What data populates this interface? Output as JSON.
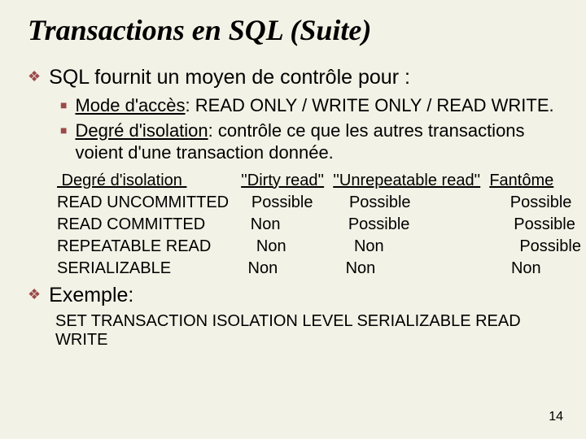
{
  "title": "Transactions en SQL (Suite)",
  "b1_intro": "SQL fournit un moyen de contrôle pour :",
  "sub1_label": "Mode d'accès",
  "sub1_rest": ": READ ONLY / WRITE ONLY / READ WRITE.",
  "sub2_label": "Degré d'isolation",
  "sub2_rest": ": contrôle ce que les autres transactions voient d'une transaction donnée.",
  "hdr_level": " Degré d'isolation ",
  "hdr_dirty": "''Dirty read''",
  "hdr_unrep": "''Unrepeatable read''",
  "hdr_phantom": "Fantôme",
  "gap1": "            ",
  "gap2": "  ",
  "gap3": "  ",
  "r1_level": "READ UNCOMMITTED",
  "r1_dirty": "     Possible",
  "r1_unrep": "        Possible",
  "r1_phantom": "                      Possible",
  "r2_level": "READ COMMITTED",
  "r2_dirty": "          Non",
  "r2_unrep": "               Possible",
  "r2_phantom": "                       Possible",
  "r3_level": "REPEATABLE READ",
  "r3_dirty": "          Non",
  "r3_unrep": "               Non",
  "r3_phantom": "                              Possible",
  "r4_level": "SERIALIZABLE",
  "r4_dirty": "                 Non",
  "r4_unrep": "               Non",
  "r4_phantom": "                              Non",
  "b2_example": "Exemple:",
  "code": "SET TRANSACTION ISOLATION LEVEL  SERIALIZABLE READ WRITE",
  "pagenum": "14",
  "chart_data": {
    "type": "table",
    "title": "Degré d'isolation vs anomalies",
    "columns": [
      "Degré d'isolation",
      "''Dirty read''",
      "''Unrepeatable read''",
      "Fantôme"
    ],
    "rows": [
      [
        "READ UNCOMMITTED",
        "Possible",
        "Possible",
        "Possible"
      ],
      [
        "READ COMMITTED",
        "Non",
        "Possible",
        "Possible"
      ],
      [
        "REPEATABLE READ",
        "Non",
        "Non",
        "Possible"
      ],
      [
        "SERIALIZABLE",
        "Non",
        "Non",
        "Non"
      ]
    ]
  }
}
